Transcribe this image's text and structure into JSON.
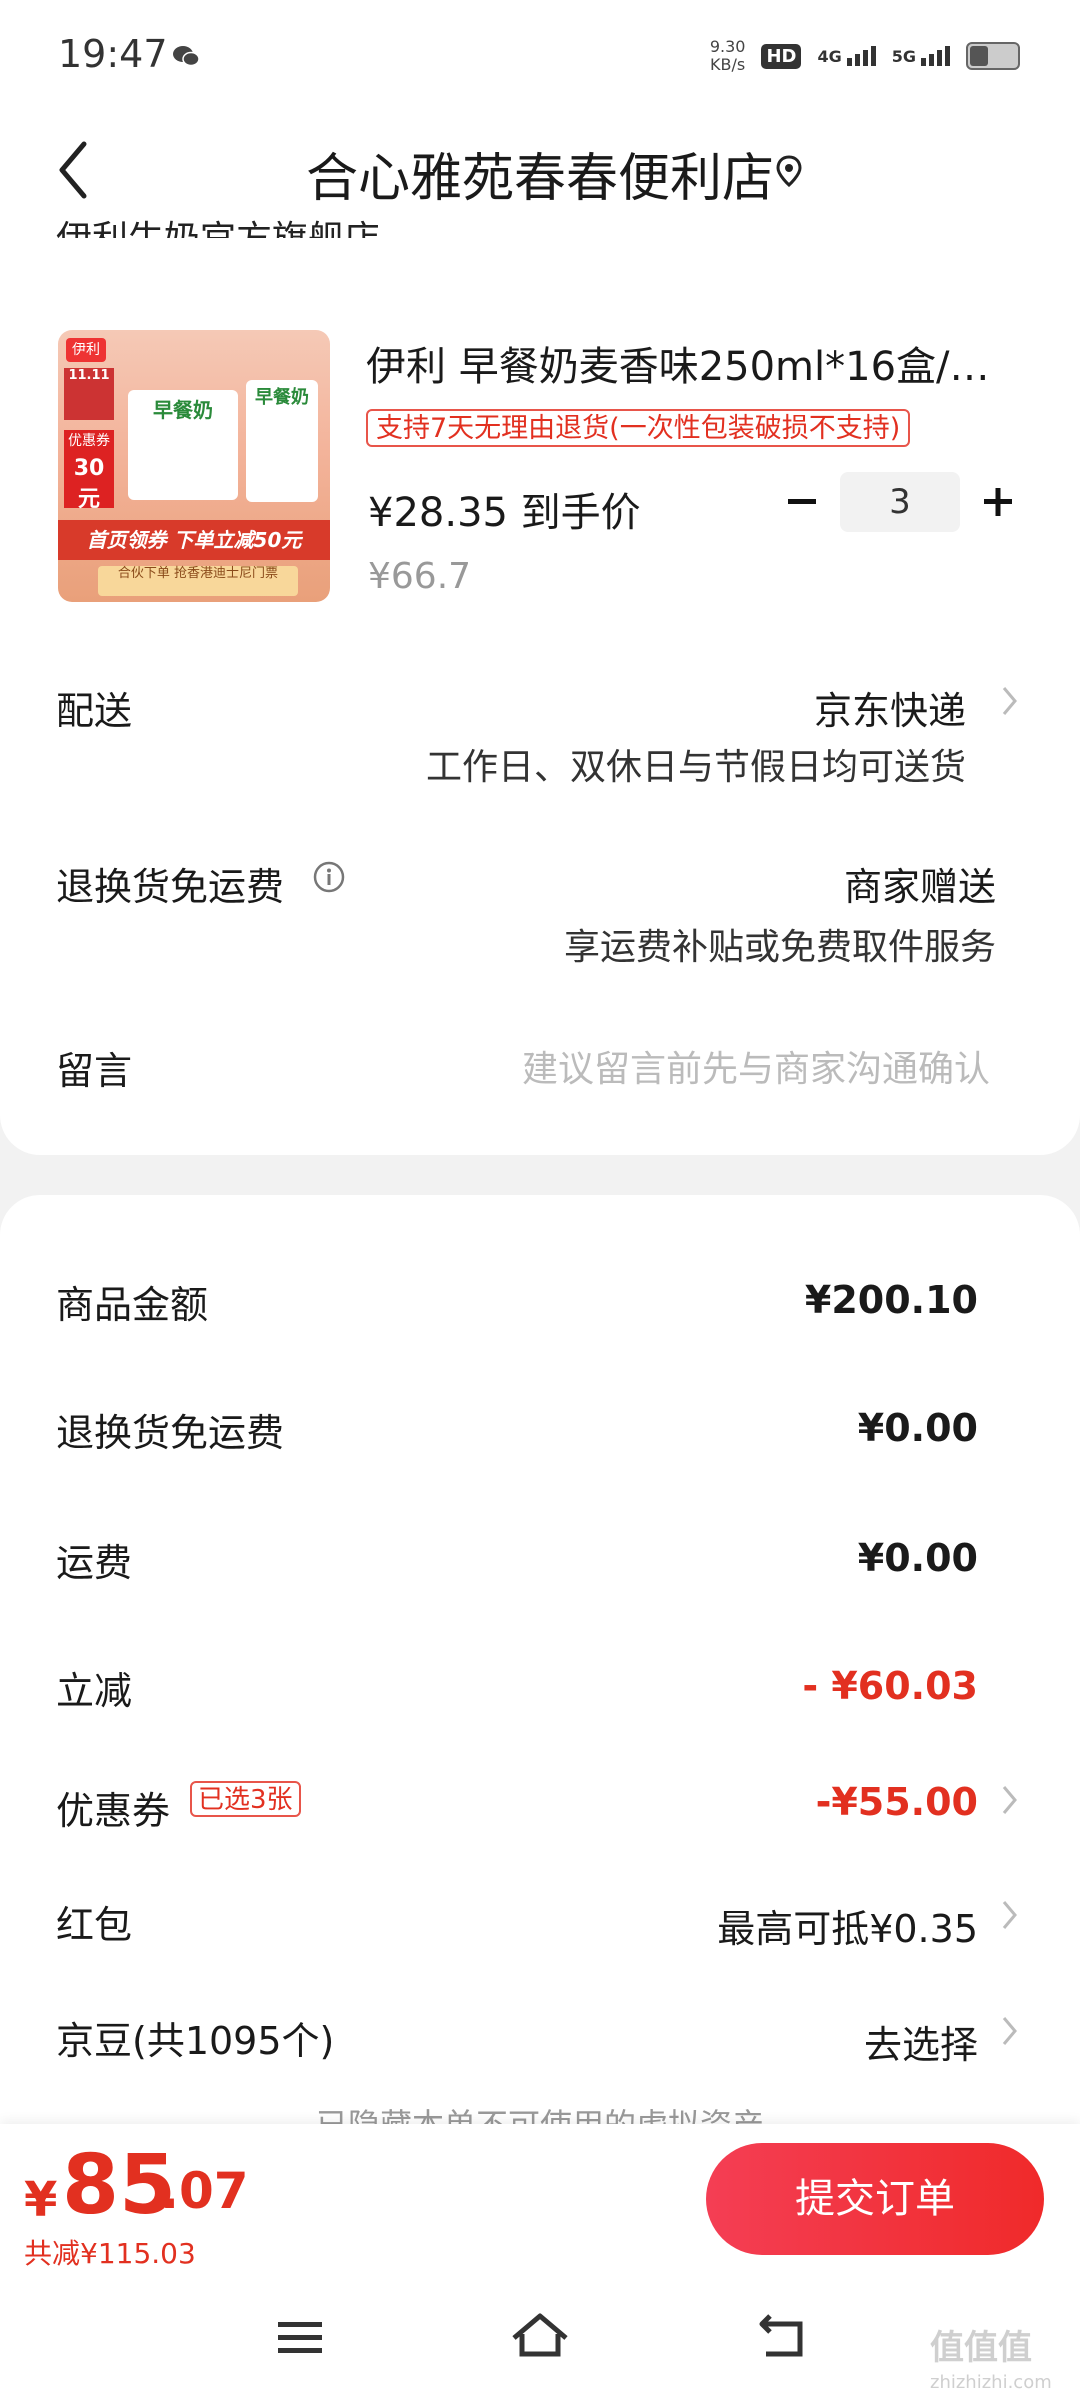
{
  "status_bar": {
    "time": "19:47",
    "net_speed_value": "9.30",
    "net_speed_unit": "KB/s",
    "hd_label": "HD",
    "sim1_label": "4G",
    "sim2_label": "5G"
  },
  "header": {
    "title": "合心雅苑春春便利店"
  },
  "shop": {
    "name_partial": "伊利牛奶官方旗舰店"
  },
  "product": {
    "title": "伊利 早餐奶麦香味250ml*16盒/…",
    "return_policy": "支持7天无理由退货(一次性包装破损不支持)",
    "final_price": "¥28.35 到手价",
    "original_price": "¥66.7",
    "quantity": "3",
    "image_text": {
      "brand": "伊利",
      "event": "11.11",
      "badge_label": "优惠券",
      "badge_value": "30元",
      "box_label": "早餐奶",
      "promo": "首页领券 下单立减50元",
      "bottom": "合伙下单 抢香港迪士尼门票"
    }
  },
  "delivery": {
    "label": "配送",
    "value": "京东快递",
    "note": "工作日、双休日与节假日均可送货"
  },
  "return_shipping": {
    "label": "退换货免运费",
    "value": "商家赠送",
    "note": "享运费补贴或免费取件服务"
  },
  "message": {
    "label": "留言",
    "placeholder": "建议留言前先与商家沟通确认"
  },
  "summary": {
    "goods_amount_label": "商品金额",
    "goods_amount": "¥200.10",
    "return_fee_label": "退换货免运费",
    "return_fee": "¥0.00",
    "shipping_label": "运费",
    "shipping": "¥0.00",
    "instant_discount_label": "立减",
    "instant_discount": "- ¥60.03",
    "coupon_label": "优惠券",
    "coupon_tag": "已选3张",
    "coupon_value": "-¥55.00",
    "redpacket_label": "红包",
    "redpacket_value": "最高可抵¥0.35",
    "jingdou_label": "京豆(共1095个)",
    "jingdou_value": "去选择",
    "hidden_assets_text": "已隐藏本单不可使用的虚拟资产"
  },
  "footer": {
    "currency": "¥",
    "total_int": "85",
    "total_dec": ".07",
    "saved": "共减¥115.03",
    "submit_label": "提交订单"
  },
  "watermark": {
    "text": "值值值",
    "sub": "zhizhizhi.com"
  },
  "colors": {
    "accent_red": "#e23020",
    "button_red": "#f02a2a",
    "background": "#f2f2f2"
  }
}
